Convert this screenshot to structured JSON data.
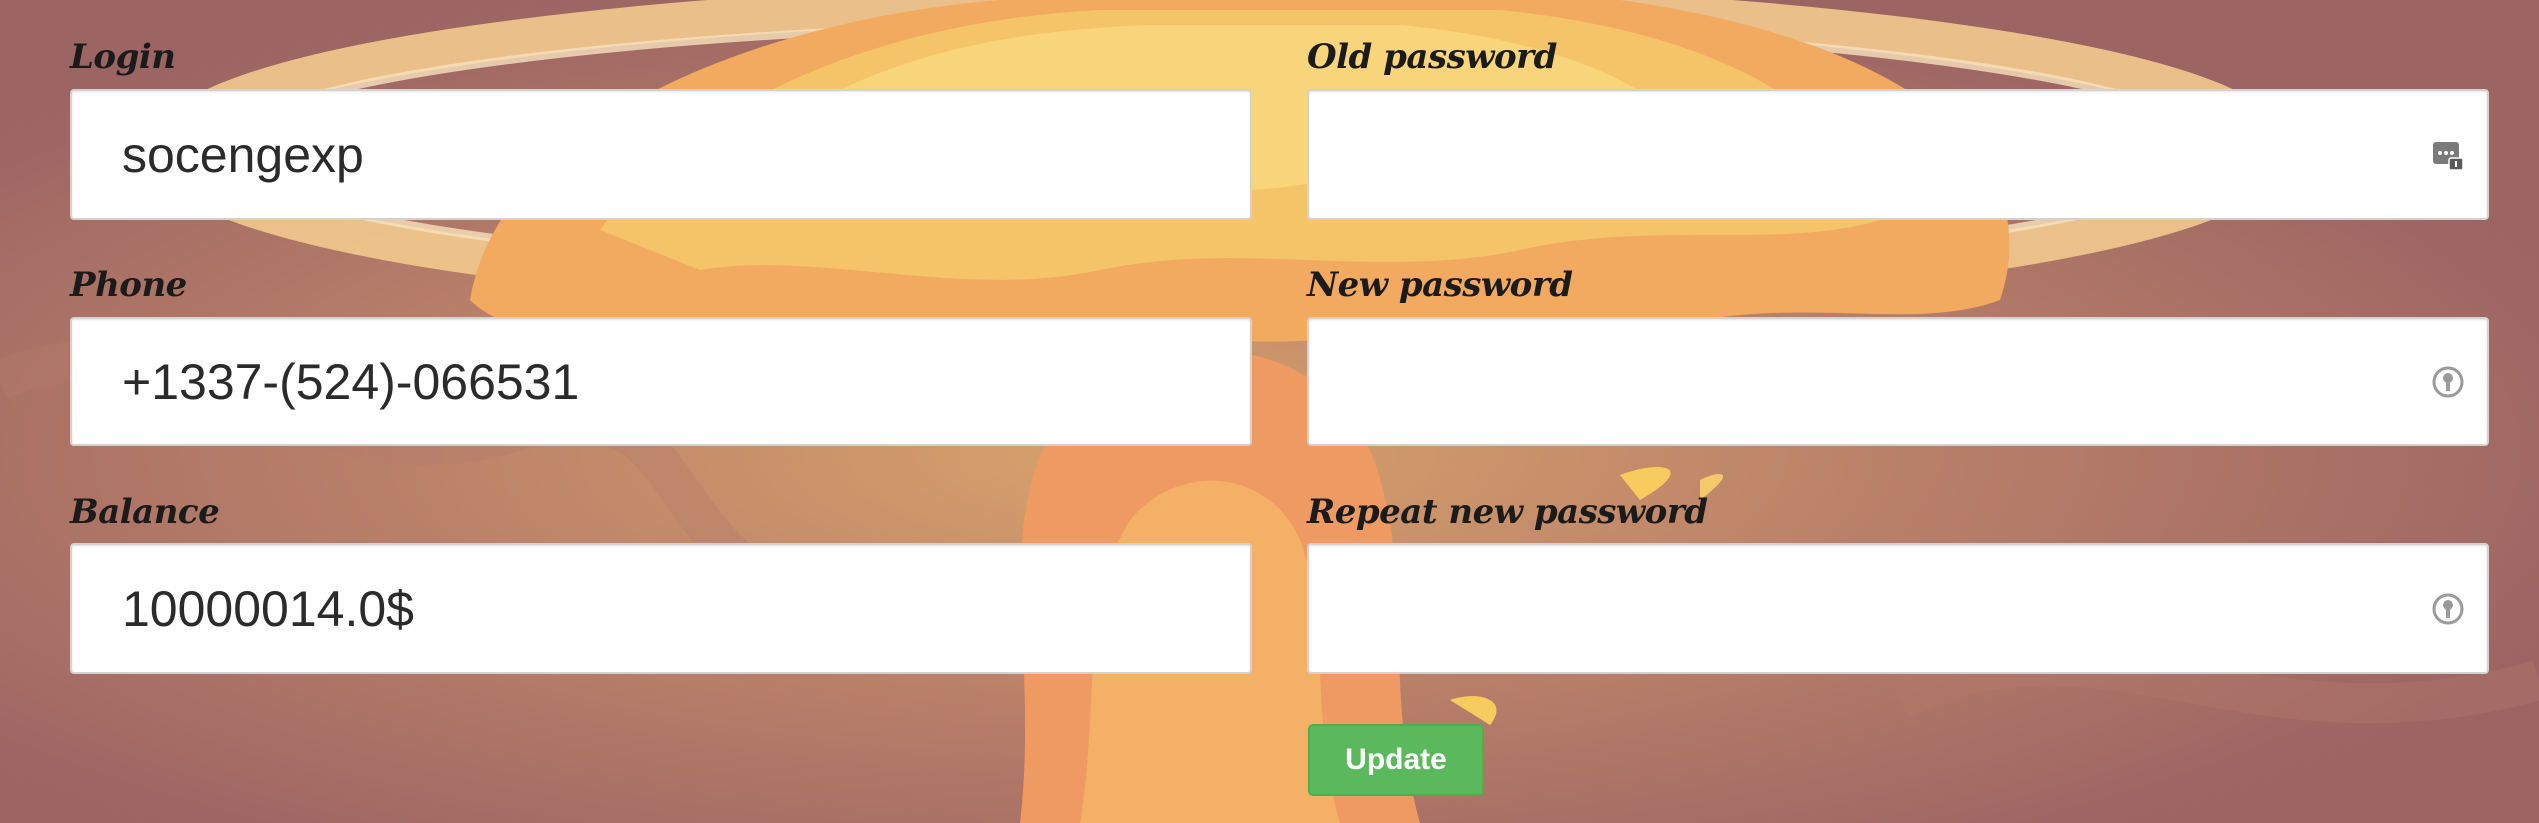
{
  "form": {
    "login": {
      "label": "Login",
      "value": "socengexp"
    },
    "phone": {
      "label": "Phone",
      "value": "+1337-(524)-066531"
    },
    "balance": {
      "label": "Balance",
      "value": "10000014.0$"
    },
    "old_password": {
      "label": "Old password",
      "value": "",
      "icon": "password-manager-icon"
    },
    "new_password": {
      "label": "New password",
      "value": "",
      "icon": "key-icon"
    },
    "repeat_new_password": {
      "label": "Repeat new password",
      "value": "",
      "icon": "key-icon"
    },
    "update_button": {
      "label": "Update",
      "color": "#5cb85c"
    }
  },
  "theme": {
    "background": "#a8706a",
    "cloud_color": "#f5c86a"
  }
}
